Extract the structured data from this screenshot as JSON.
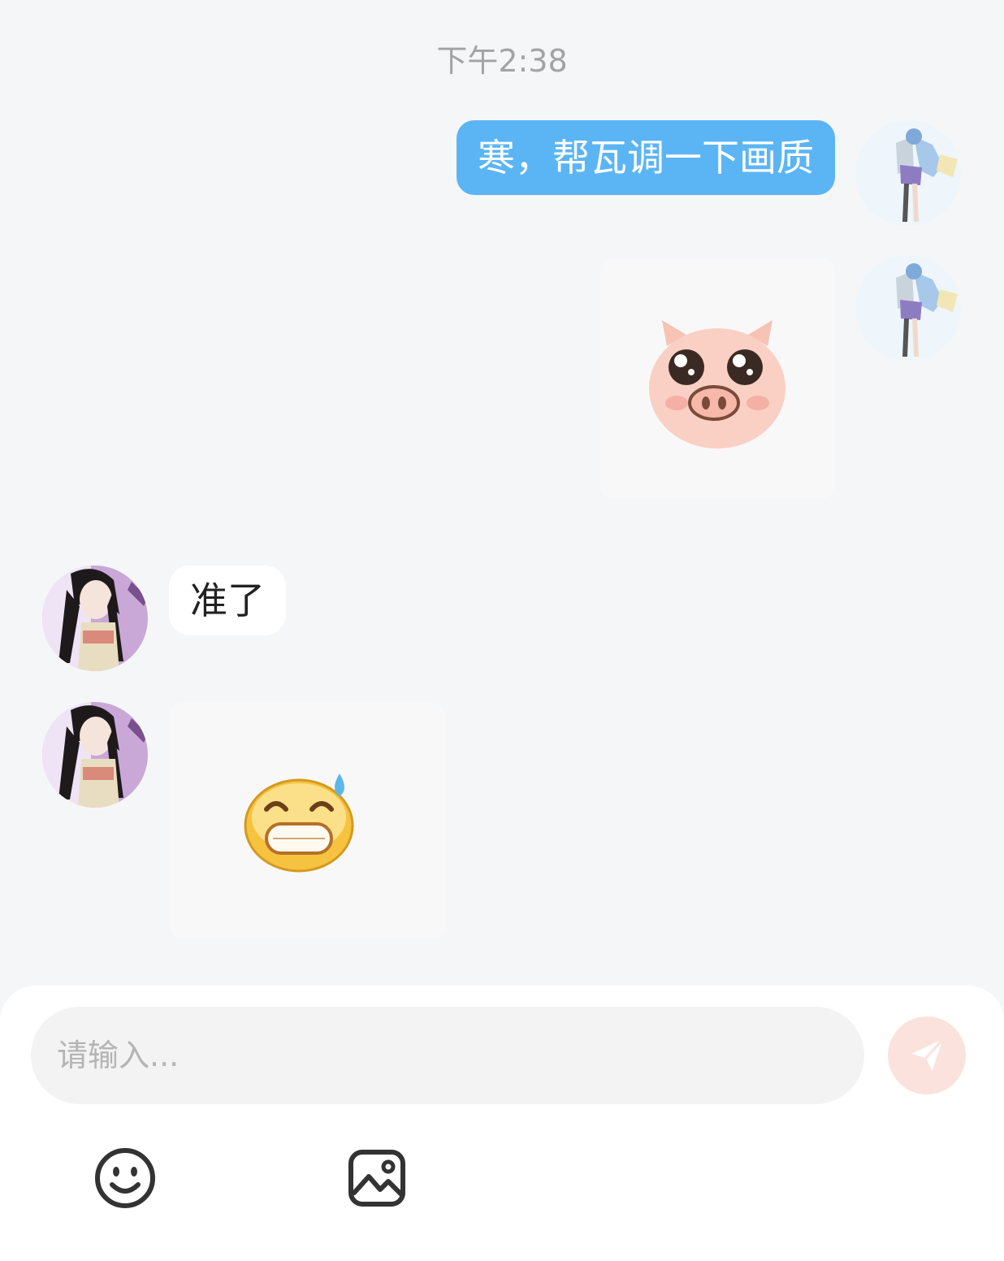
{
  "chat": {
    "timestamp": "下午2:38",
    "messages": [
      {
        "side": "outgoing",
        "kind": "text",
        "text": "寒，帮瓦调一下画质"
      },
      {
        "side": "outgoing",
        "kind": "sticker",
        "sticker": "pig-face"
      },
      {
        "side": "incoming",
        "kind": "text",
        "text": "准了"
      },
      {
        "side": "incoming",
        "kind": "sticker",
        "sticker": "sweat-grin-face"
      }
    ]
  },
  "composer": {
    "placeholder": "请输入...",
    "send_icon": "paper-plane-icon",
    "tools": [
      "emoji-icon",
      "image-icon"
    ]
  },
  "colors": {
    "background": "#f5f6f8",
    "outgoing_bubble": "#5bb5f5",
    "incoming_bubble": "#ffffff",
    "send_button": "#fbe2dd"
  }
}
